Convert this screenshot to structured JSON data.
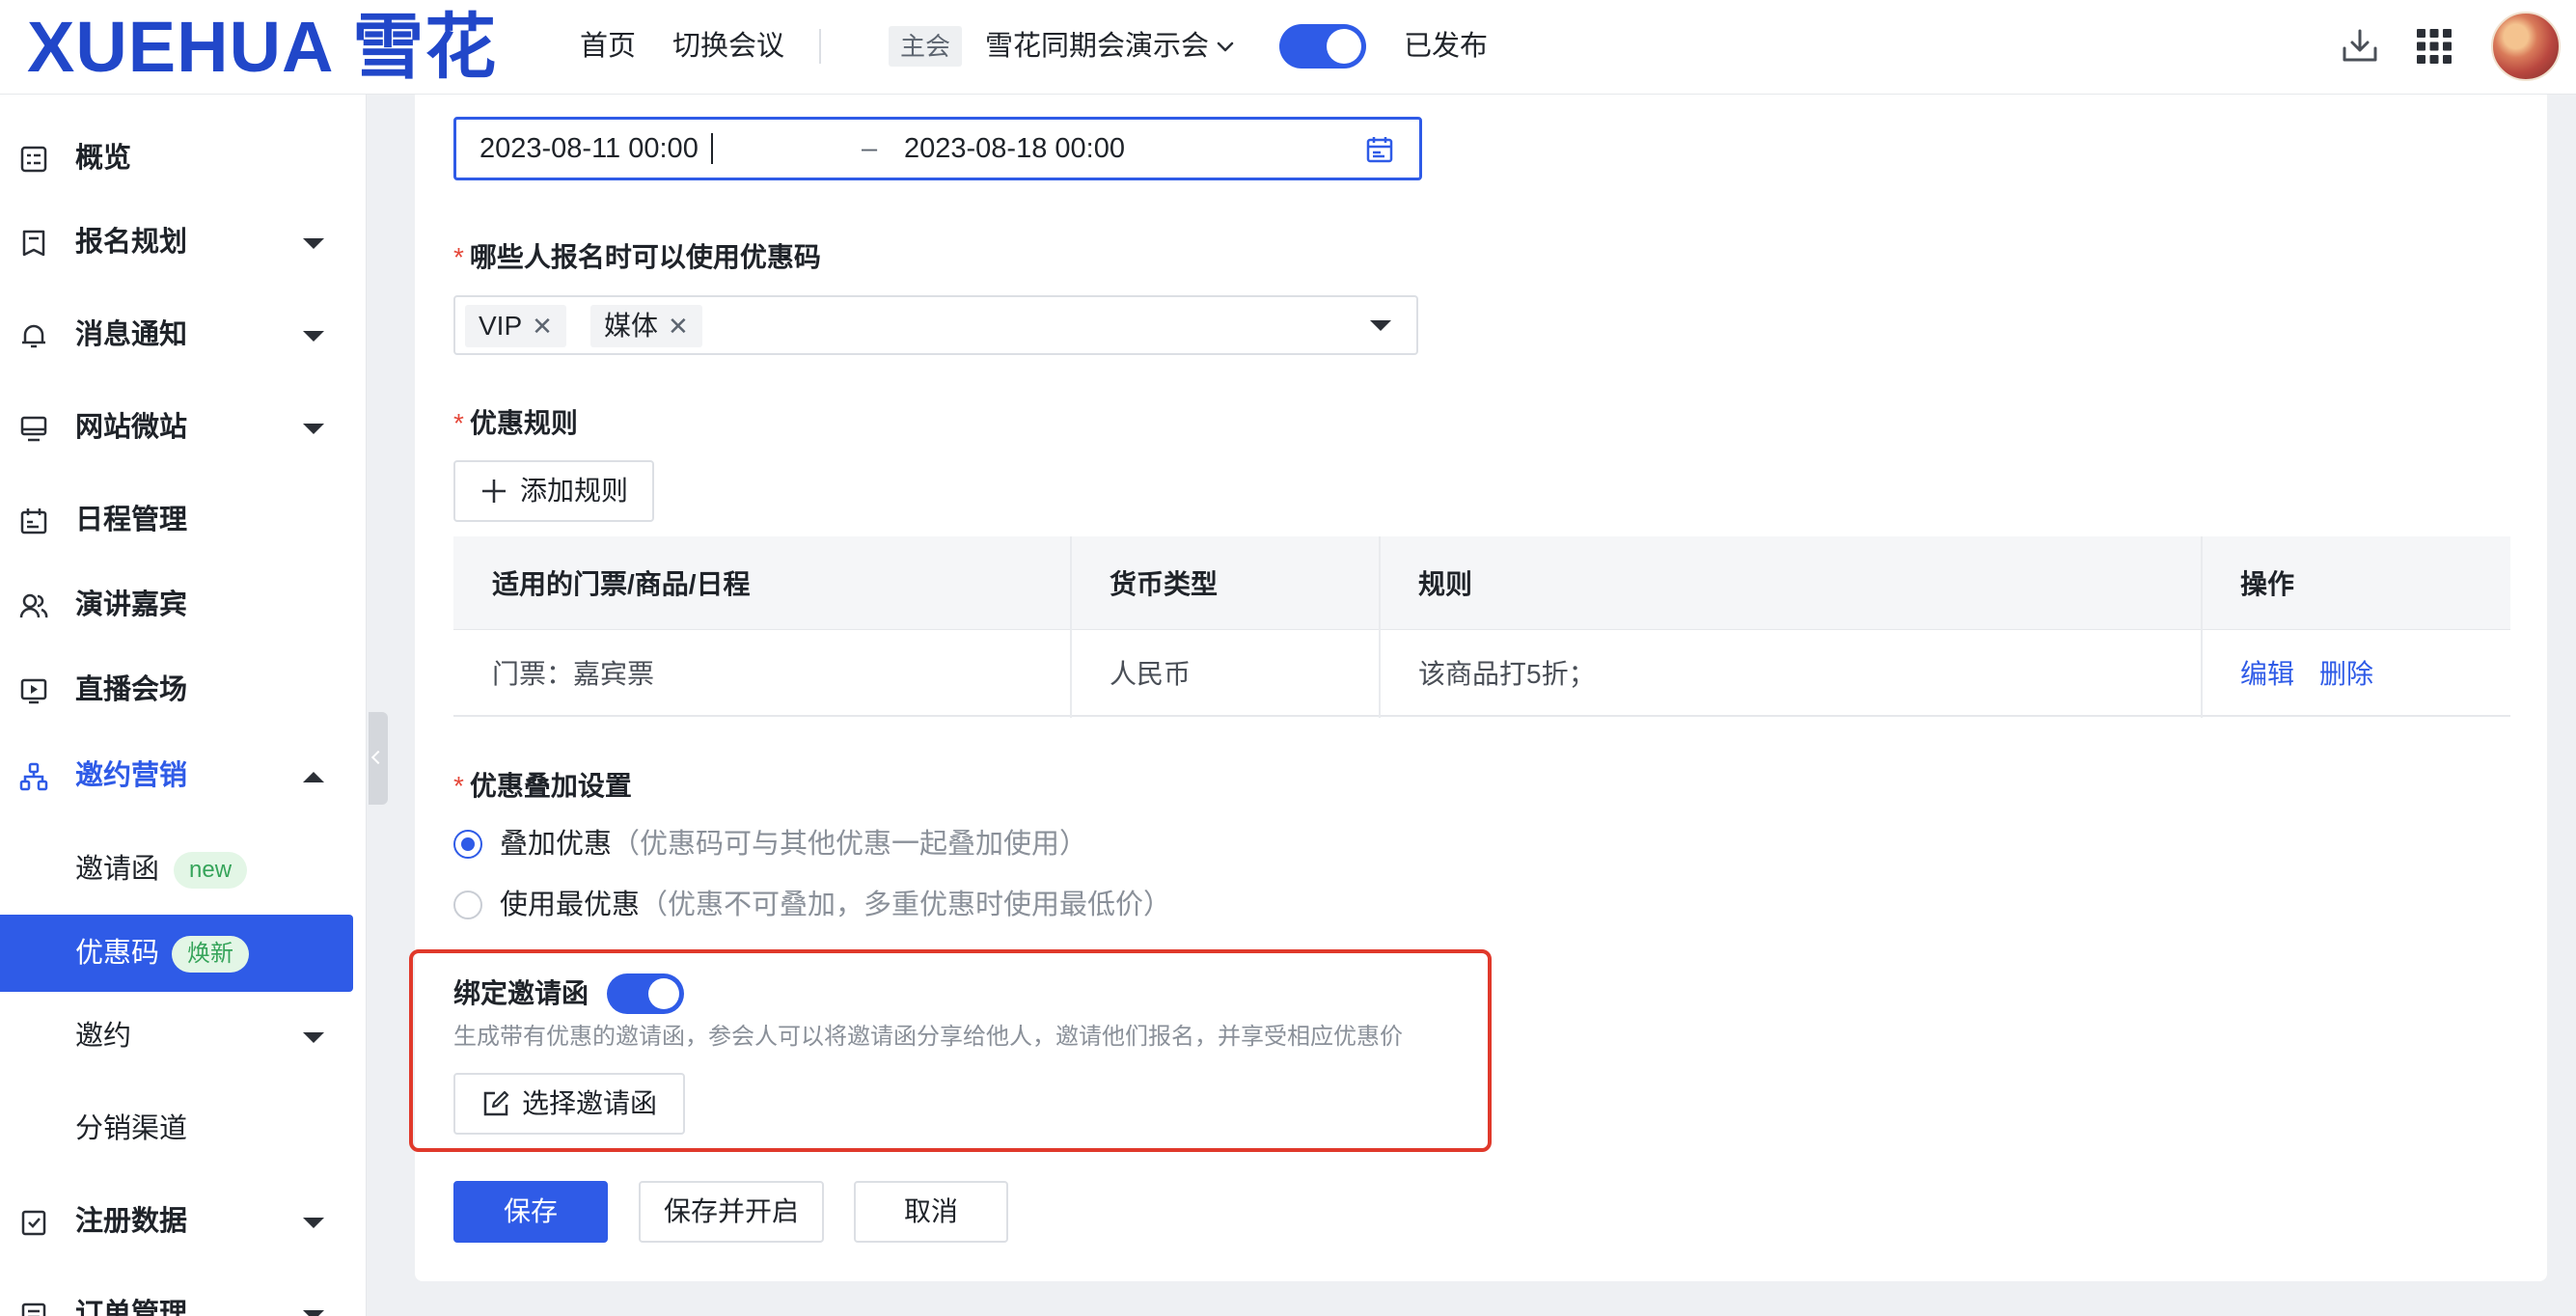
{
  "header": {
    "logo_text": "XUEHUA 雪花",
    "nav": [
      "首页",
      "切换会议"
    ],
    "event_tag": "主会",
    "event_name": "雪花同期会演示会",
    "publish_toggle_on": true,
    "publish_status": "已发布",
    "icons": [
      "download-icon",
      "apps-grid-icon",
      "user-avatar"
    ]
  },
  "sidebar": {
    "items": [
      {
        "label": "概览",
        "icon": "overview-icon",
        "arrow": "none"
      },
      {
        "label": "报名规划",
        "icon": "form-icon",
        "arrow": "down"
      },
      {
        "label": "消息通知",
        "icon": "bell-icon",
        "arrow": "down"
      },
      {
        "label": "网站微站",
        "icon": "monitor-icon",
        "arrow": "down"
      },
      {
        "label": "日程管理",
        "icon": "calendar-icon",
        "arrow": "none"
      },
      {
        "label": "演讲嘉宾",
        "icon": "people-icon",
        "arrow": "none"
      },
      {
        "label": "直播会场",
        "icon": "live-icon",
        "arrow": "none"
      },
      {
        "label": "邀约营销",
        "icon": "network-icon",
        "arrow": "up",
        "active": true
      }
    ],
    "sub_items": [
      {
        "label": "邀请函",
        "badge": "new"
      },
      {
        "label": "优惠码",
        "badge": "焕新",
        "selected": true
      },
      {
        "label": "邀约",
        "arrow": "down"
      },
      {
        "label": "分销渠道"
      }
    ],
    "bottom_items": [
      {
        "label": "注册数据",
        "icon": "checklist-icon",
        "arrow": "down"
      },
      {
        "label": "订单管理",
        "icon": "order-icon",
        "arrow": "down"
      }
    ]
  },
  "form": {
    "date_start": "2023-08-11 00:00",
    "date_sep": "–",
    "date_end": "2023-08-18 00:00",
    "who_label": "哪些人报名时可以使用优惠码",
    "who_tags": [
      "VIP",
      "媒体"
    ],
    "rules_label": "优惠规则",
    "add_rule_button": "添加规则",
    "table": {
      "headers": [
        "适用的门票/商品/日程",
        "货币类型",
        "规则",
        "操作"
      ],
      "rows": [
        {
          "item": "门票：嘉宾票",
          "currency": "人民币",
          "rule": "该商品打5折；",
          "actions": [
            "编辑",
            "删除"
          ]
        }
      ]
    },
    "stack_label": "优惠叠加设置",
    "stack_options": [
      {
        "label": "叠加优惠",
        "hint": "（优惠码可与其他优惠一起叠加使用）",
        "checked": true
      },
      {
        "label": "使用最优惠",
        "hint": "（优惠不可叠加，多重优惠时使用最低价）",
        "checked": false
      }
    ],
    "bind_label": "绑定邀请函",
    "bind_toggle_on": true,
    "bind_desc": "生成带有优惠的邀请函，参会人可以将邀请函分享给他人，邀请他们报名，并享受相应优惠价",
    "select_invite_button": "选择邀请函",
    "save_button": "保存",
    "save_open_button": "保存并开启",
    "cancel_button": "取消"
  },
  "colors": {
    "accent": "#2f5be7",
    "highlight": "#e0392b",
    "required": "#e5483a"
  }
}
